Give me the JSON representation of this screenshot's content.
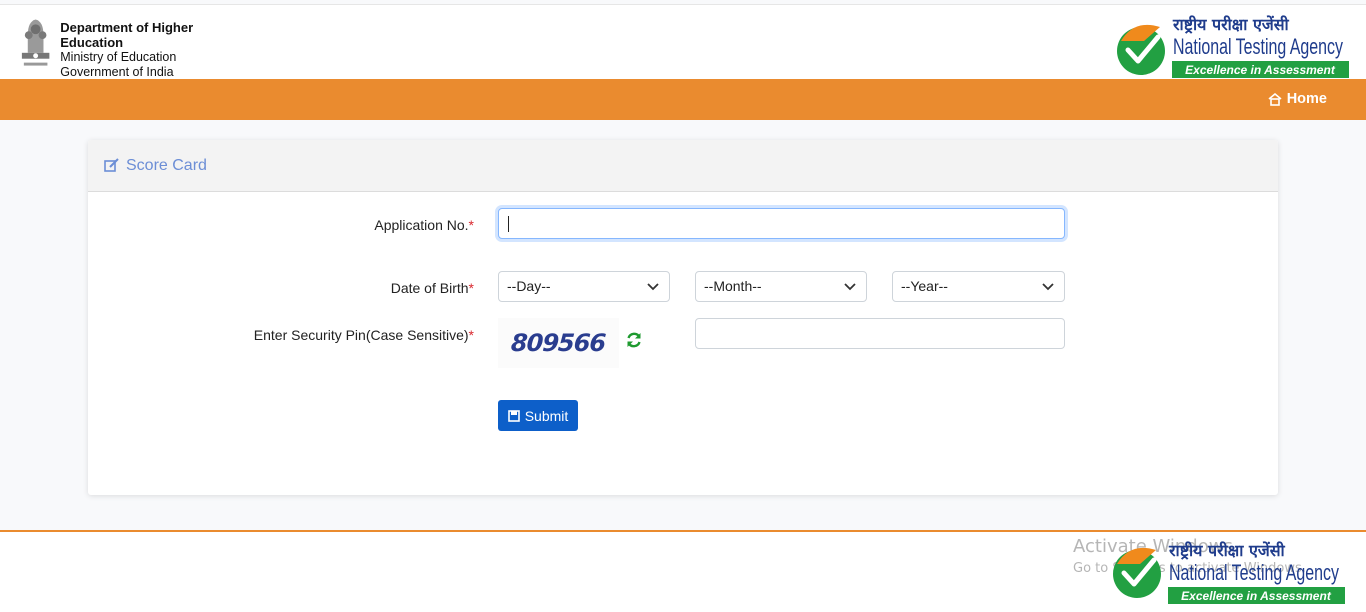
{
  "header": {
    "dhe_line1": "Department of Higher Education",
    "dhe_line2": "Ministry of Education",
    "dhe_line3": "Government of India",
    "nta_hindi": "राष्ट्रीय परीक्षा एजेंसी",
    "nta_english": "National Testing Agency",
    "nta_tagline": "Excellence in Assessment"
  },
  "nav": {
    "home_label": "Home",
    "home_icon": "home-icon"
  },
  "card": {
    "title": "Score Card",
    "title_icon": "edit-icon"
  },
  "form": {
    "application_label": "Application No.",
    "dob_label": "Date of Birth",
    "day_placeholder": "--Day--",
    "month_placeholder": "--Month--",
    "year_placeholder": "--Year--",
    "pin_label": "Enter Security Pin(Case Sensitive)",
    "required_mark": "*",
    "captcha_value": "809566",
    "submit_label": "Submit"
  },
  "watermark": {
    "line1": "Activate Windows",
    "line2": "Go to Settings to activate Windows."
  },
  "colors": {
    "nav_orange": "#ea8b2f",
    "card_title_blue": "#6c8ed6",
    "submit_blue": "#0d5fc9",
    "nta_green": "#22a042"
  }
}
